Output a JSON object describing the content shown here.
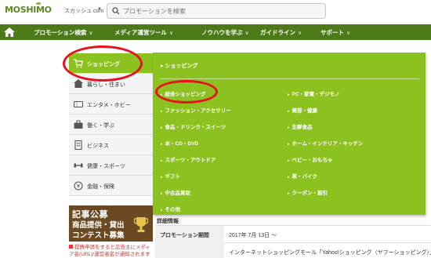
{
  "header": {
    "logo_text": "MOSHIMO",
    "site_select": "スカッシュ.com",
    "search_placeholder": "プロモーションを検索"
  },
  "nav": {
    "items": [
      {
        "label": "プロモーション検索"
      },
      {
        "label": "メディア運営ツール"
      },
      {
        "label": "ノウハウを学ぶ"
      },
      {
        "label": "ガイドライン"
      },
      {
        "label": "サポート"
      }
    ]
  },
  "sidebar": {
    "items": [
      {
        "label": "ショッピング"
      },
      {
        "label": "暮らし・住まい"
      },
      {
        "label": "エンタメ・ホビー"
      },
      {
        "label": "働く・学ぶ"
      },
      {
        "label": "ビジネス"
      },
      {
        "label": "健康・スポーツ"
      },
      {
        "label": "金融・保険"
      }
    ]
  },
  "banner": {
    "line1": "記事公募",
    "line2": "商品提供・貸出",
    "line3": "コンテスト募集"
  },
  "notice": {
    "text": "提携申請をすると広告主にメディア名(URL)/運営者名が通知されます"
  },
  "dropdown": {
    "heading": "ショッピング",
    "left_links": [
      "総合ショッピング",
      "ファッション・アクセサリー",
      "食品・ドリンク・スイーツ",
      "本・CD・DVD",
      "スポーツ・アウトドア",
      "ギフト",
      "中古品買取",
      "その他"
    ],
    "right_links": [
      "PC・家電・デジモノ",
      "美容・健康",
      "生鮮食品",
      "ホーム・インテリア・キッチン",
      "ベビー・おもちゃ",
      "車・バイク",
      "クーポン・割引"
    ]
  },
  "details": {
    "heading": "詳細情報",
    "rows": [
      {
        "key": "プロモーション期間",
        "value": "2017年 7月 13日 〜"
      },
      {
        "key": "",
        "value": "インターネットショッピングモール「Yahoo!ショッピング（ヤフーショッピング）」"
      }
    ]
  },
  "colors": {
    "nav_bg": "#4c7a19",
    "accent_green": "#8cc21f",
    "annotation_red": "#e8101c"
  }
}
